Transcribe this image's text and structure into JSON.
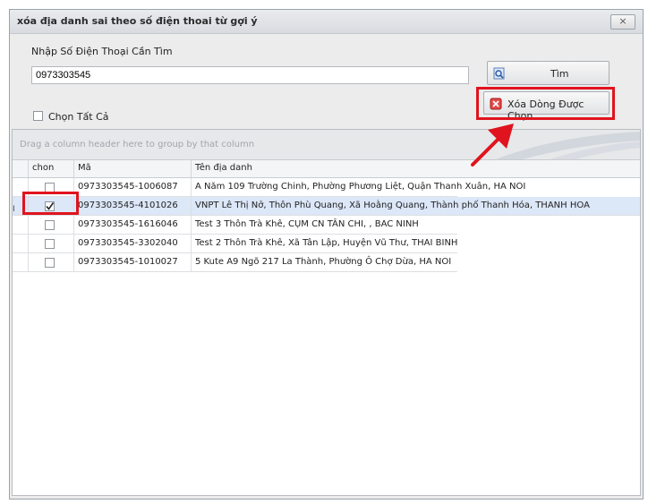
{
  "window": {
    "title": "xóa địa danh sai theo số điện thoai từ gợi ý",
    "close_label": "×"
  },
  "search": {
    "label": "Nhập Số Điện Thoại Cần Tìm",
    "value": "0973303545"
  },
  "buttons": {
    "find_label": "Tìm",
    "delete_label": "Xóa Dòng Được Chọn"
  },
  "select_all": {
    "label": "Chọn Tất Cả",
    "checked": false
  },
  "grid": {
    "group_hint": "Drag a column header here to group by that column",
    "columns": [
      "chon",
      "Mã",
      "Tên địa danh"
    ],
    "rows": [
      {
        "checked": false,
        "ma": "0973303545-1006087",
        "ten": "A Năm  109 Trường Chinh, Phường Phương Liệt, Quận Thanh Xuân, HA NOI"
      },
      {
        "checked": true,
        "ma": "0973303545-4101026",
        "ten": "VNPT  Lê Thị Nở, Thôn Phù Quang, Xã Hoằng Quang, Thành phố Thanh Hóa, THANH HOA"
      },
      {
        "checked": false,
        "ma": "0973303545-1616046",
        "ten": "Test 3  Thôn Trà Khê, CỤM CN TÂN CHI, , BAC NINH"
      },
      {
        "checked": false,
        "ma": "0973303545-3302040",
        "ten": "Test 2  Thôn Trà Khê, Xã Tân Lập, Huyện Vũ Thư, THAI BINH"
      },
      {
        "checked": false,
        "ma": "0973303545-1010027",
        "ten": "5 Kute  A9 Ngõ 217 La Thành, Phường Ô Chợ Dừa,  HA NOI"
      }
    ],
    "row_indicator": "I"
  },
  "colors": {
    "highlight": "#e0141e",
    "selected_row": "#dce7f8"
  }
}
